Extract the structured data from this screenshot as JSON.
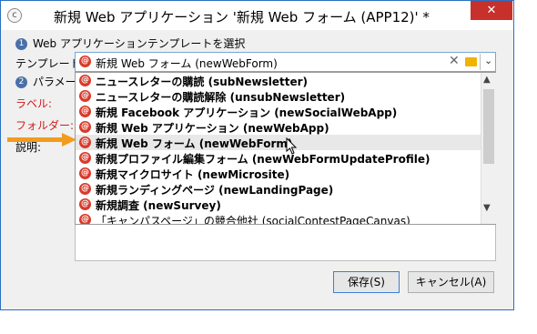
{
  "window": {
    "title": "新規 Web アプリケーション '新規 Web フォーム (APP12)' *",
    "app_icon": "adobe-campaign-icon",
    "close_label": "✕"
  },
  "step1": {
    "number": "1",
    "label": "Web アプリケーションテンプレートを選択"
  },
  "step2": {
    "number": "2",
    "label": "パラメータ"
  },
  "fields": {
    "template_label": "テンプレート:",
    "label_label": "ラベル:",
    "folder_label": "フォルダー:",
    "description_label": "説明:"
  },
  "combo": {
    "value": "新規 Web フォーム (newWebForm)",
    "icon": "at-sign-icon",
    "clear_label": "✕",
    "dropdown_label": "⌄"
  },
  "list_items": [
    {
      "label": "ニュースレターの購読 (subNewsletter)"
    },
    {
      "label": "ニュースレターの購読解除 (unsubNewsletter)"
    },
    {
      "label": "新規 Facebook アプリケーション (newSocialWebApp)"
    },
    {
      "label": "新規 Web アプリケーション (newWebApp)"
    },
    {
      "label": "新規 Web フォーム (newWebForm)"
    },
    {
      "label": "新規プロファイル編集フォーム (newWebFormUpdateProfile)"
    },
    {
      "label": "新規マイクロサイト (newMicrosite)"
    },
    {
      "label": "新規ランディングページ (newLandingPage)"
    },
    {
      "label": "新規調査 (newSurvey)"
    },
    {
      "label": "「キャンパスページ」の競合他社 (socialContestPageCanvas)"
    }
  ],
  "scrollbar": {
    "up": "▲",
    "down": "▼"
  },
  "buttons": {
    "save": "保存(S)",
    "cancel": "キャンセル(A)"
  },
  "colors": {
    "accent": "#2b6fbf",
    "close": "#c7302b",
    "arrow": "#f29b1e",
    "required": "#d01b1b"
  }
}
